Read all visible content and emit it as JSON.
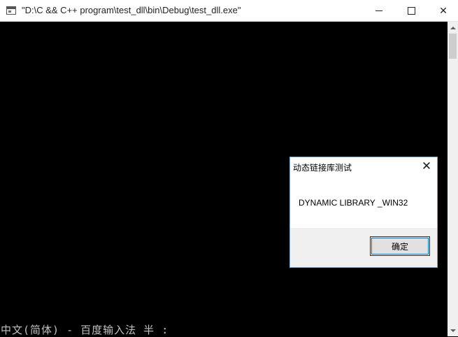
{
  "window": {
    "title": "\"D:\\C && C++ program\\test_dll\\bin\\Debug\\test_dll.exe\"",
    "minimize_glyph": "minimize",
    "maximize_glyph": "maximize",
    "close_glyph": "✕"
  },
  "console": {
    "ime_status": "中文(简体) - 百度输入法 半 :"
  },
  "dialog": {
    "title": "动态链接库测试",
    "close_glyph": "✕",
    "message": "DYNAMIC LIBRARY _WIN32",
    "ok_label": "确定"
  },
  "colors": {
    "console_bg": "#000000",
    "dialog_border": "#7aa7d6",
    "focus": "#0078d7"
  }
}
